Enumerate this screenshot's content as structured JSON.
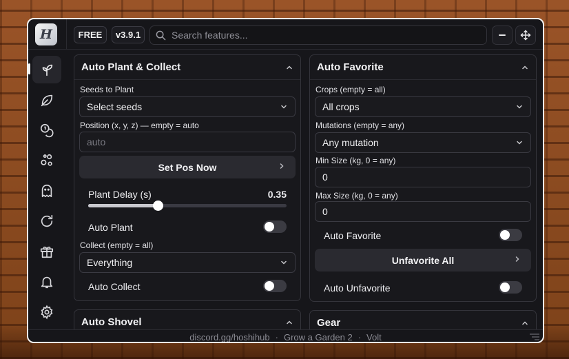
{
  "topbar": {
    "logo_letter": "H",
    "plan_badge": "FREE",
    "version_badge": "v3.9.1",
    "search_placeholder": "Search features..."
  },
  "sidebar": {
    "items": [
      {
        "icon": "sprout-icon",
        "active": true
      },
      {
        "icon": "leaf-icon"
      },
      {
        "icon": "coins-icon"
      },
      {
        "icon": "seeds-icon"
      },
      {
        "icon": "ghost-icon"
      },
      {
        "icon": "refresh-icon"
      },
      {
        "icon": "gift-icon"
      },
      {
        "icon": "bell-icon"
      },
      {
        "icon": "gear-icon"
      }
    ]
  },
  "auto_plant": {
    "title": "Auto Plant & Collect",
    "seeds_label": "Seeds to Plant",
    "seeds_value": "Select seeds",
    "position_label": "Position (x, y, z) — empty = auto",
    "position_placeholder": "auto",
    "set_pos_button": "Set Pos Now",
    "plant_delay_label": "Plant Delay (s)",
    "plant_delay_value": "0.35",
    "plant_delay_fraction": 0.35,
    "auto_plant_label": "Auto Plant",
    "auto_plant_on": false,
    "collect_label": "Collect (empty = all)",
    "collect_value": "Everything",
    "auto_collect_label": "Auto Collect",
    "auto_collect_on": false
  },
  "auto_favorite": {
    "title": "Auto Favorite",
    "crops_label": "Crops (empty = all)",
    "crops_value": "All crops",
    "mutations_label": "Mutations (empty = any)",
    "mutations_value": "Any mutation",
    "min_size_label": "Min Size (kg, 0 = any)",
    "min_size_value": "0",
    "max_size_label": "Max Size (kg, 0 = any)",
    "max_size_value": "0",
    "auto_favorite_label": "Auto Favorite",
    "auto_favorite_on": false,
    "unfavorite_all_button": "Unfavorite All",
    "auto_unfavorite_label": "Auto Unfavorite",
    "auto_unfavorite_on": false
  },
  "lower_cards": {
    "left_title": "Auto Shovel",
    "right_title": "Gear"
  },
  "footer": {
    "discord": "discord.gg/hoshihub",
    "game": "Grow a Garden 2",
    "executor": "Volt",
    "separator": "·"
  },
  "colors": {
    "window_bg": "#16161a",
    "card_bg": "#18181c",
    "border": "#34343b",
    "text": "#e8e8ea",
    "muted": "#8c8c94"
  }
}
